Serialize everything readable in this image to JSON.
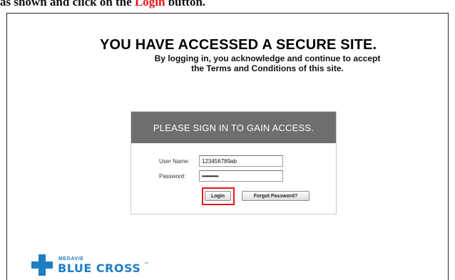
{
  "caption": {
    "prefix": "as shown and click on the ",
    "highlight": "Login",
    "suffix": " button."
  },
  "page": {
    "headline": "YOU HAVE ACCESSED A SECURE SITE.",
    "subline_1": "By logging in, you acknowledge and continue to accept",
    "subline_2": "the Terms and Conditions of this site."
  },
  "login": {
    "banner": "PLEASE SIGN IN TO GAIN ACCESS.",
    "username_label": "User Name:",
    "username_value": "123456789ab",
    "password_label": "Password:",
    "password_value": "••••••••••",
    "login_button": "Login",
    "forgot_button": "Forgot Password?"
  },
  "logo": {
    "small_text": "MEDAVIE",
    "big_text": "BLUE CROSS",
    "tm": "™",
    "icon": "cross-icon",
    "color": "#1f7dc4"
  },
  "colors": {
    "highlight": "#e8161d",
    "banner": "#6e6e6e"
  }
}
